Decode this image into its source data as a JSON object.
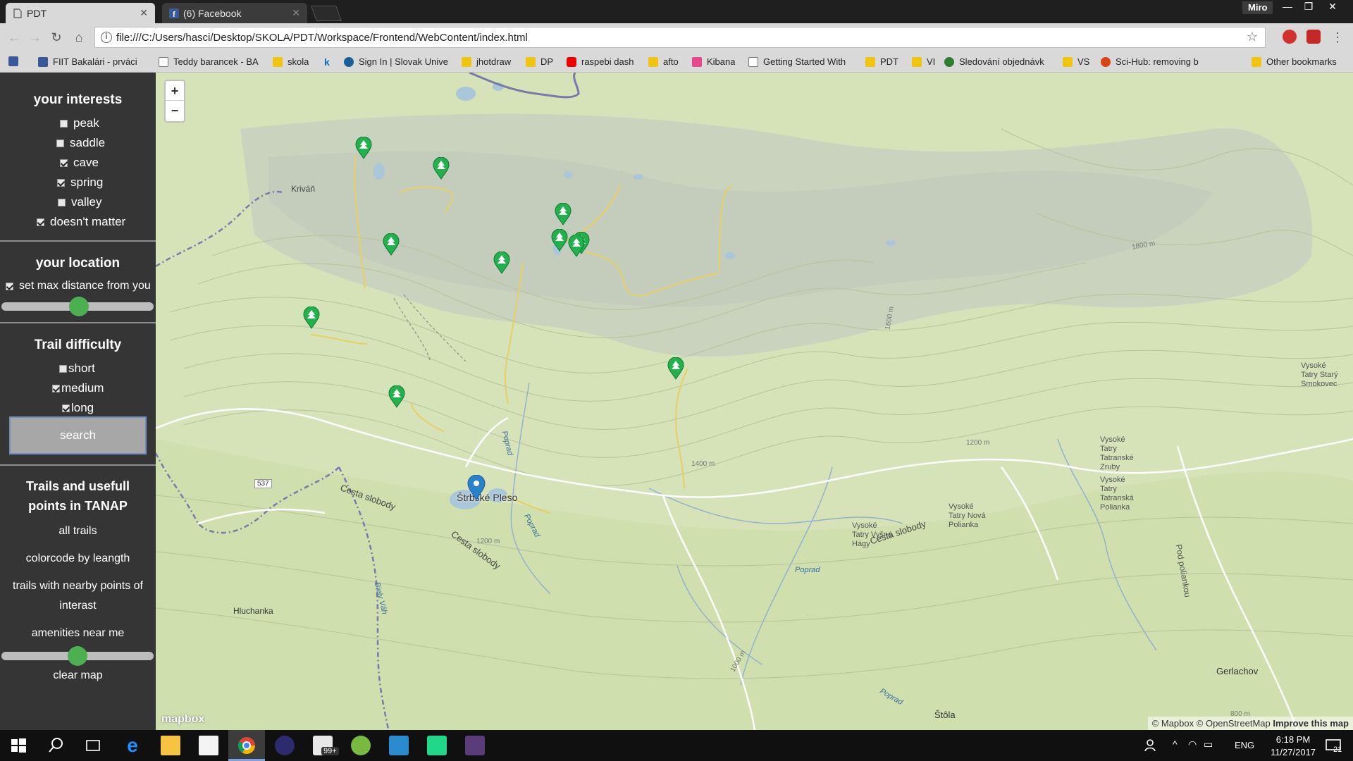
{
  "browser": {
    "tabs": [
      {
        "title": "PDT",
        "active": true
      },
      {
        "title": "(6) Facebook",
        "active": false
      }
    ],
    "user": "Miro",
    "url": "file:///C:/Users/hasci/Desktop/SKOLA/PDT/Workspace/Frontend/WebContent/index.html",
    "bookmarks": [
      {
        "label": "FIIT Bakalári - prváci",
        "icon": "facebook-icon"
      },
      {
        "label": "Teddy barancek - BA",
        "icon": "page-icon"
      },
      {
        "label": "skola",
        "icon": "folder-icon"
      },
      {
        "label": "",
        "icon": "k-icon"
      },
      {
        "label": "Sign In | Slovak Unive",
        "icon": "globe-icon"
      },
      {
        "label": "jhotdraw",
        "icon": "folder-icon"
      },
      {
        "label": "DP",
        "icon": "folder-icon"
      },
      {
        "label": "raspebi dash",
        "icon": "youtube-icon"
      },
      {
        "label": "afto",
        "icon": "folder-icon"
      },
      {
        "label": "Kibana",
        "icon": "kibana-icon"
      },
      {
        "label": "Getting Started With",
        "icon": "page-icon"
      },
      {
        "label": "PDT",
        "icon": "folder-icon"
      },
      {
        "label": "VI",
        "icon": "folder-icon"
      },
      {
        "label": "Sledování objednávk",
        "icon": "shield-icon"
      },
      {
        "label": "VS",
        "icon": "folder-icon"
      },
      {
        "label": "Sci-Hub: removing b",
        "icon": "scihub-icon"
      }
    ],
    "other_bookmarks": "Other bookmarks"
  },
  "panel": {
    "interests": {
      "title": "your interests",
      "items": [
        {
          "label": "peak",
          "checked": false
        },
        {
          "label": "saddle",
          "checked": false
        },
        {
          "label": "cave",
          "checked": true
        },
        {
          "label": "spring",
          "checked": true
        },
        {
          "label": "valley",
          "checked": false
        },
        {
          "label": "doesn't matter",
          "checked": true
        }
      ]
    },
    "location": {
      "title": "your location",
      "max_distance_label": "set max distance from you",
      "max_distance_checked": true,
      "slider_value": 0.5
    },
    "difficulty": {
      "title": "Trail difficulty",
      "items": [
        {
          "label": "short",
          "checked": false
        },
        {
          "label": "medium",
          "checked": true
        },
        {
          "label": "long",
          "checked": true
        }
      ],
      "search_label": "search"
    },
    "trails": {
      "title_line1": "Trails and usefull",
      "title_line2": "points in TANAP",
      "all_trails": "all trails",
      "colorcode": "colorcode by leangth",
      "nearby_line1": "trails with nearby points of",
      "nearby_line2": "interast",
      "amenities": "amenities near me",
      "amenities_slider_value": 0.5,
      "clear_map": "clear map"
    }
  },
  "map": {
    "zoom_in": "+",
    "zoom_out": "−",
    "labels": {
      "krivan": "Kriváň",
      "strbske_pleso": "Štrbské Pleso",
      "cesta_slobody_1": "Cesta slobody",
      "cesta_slobody_2": "Cesta slobody",
      "cesta_slobody_3": "Cesta slobody",
      "poprad_1": "Poprad",
      "poprad_2": "Poprad",
      "poprad_3": "Poprad",
      "poprad_4": "Poprad",
      "hluchanka": "Hluchanka",
      "biely_vah": "Biely Váh",
      "stola": "Štôla",
      "gerlachov": "Gerlachov",
      "pod_poliankou": "Pod poliankou",
      "vysne_hagy": "Vysoké Tatry Vyšné Hágy",
      "nova_polianka": "Vysoké Tatry Nová Polianka",
      "tatranske_zruby": "Vysoké Tatry Tatranské Zruby",
      "tatranska_polianka": "Vysoké Tatry Tatranská Polianka",
      "stary_smokovec": "Vysoké Tatry Starý Smokovec",
      "road_537": "537",
      "c1600_a": "1600 m",
      "c1400_a": "1400 m",
      "c1200_a": "1200 m",
      "c1200_b": "1200 m",
      "c1800_a": "1800 m",
      "c1000_a": "1000 m",
      "c800_a": "800 m"
    },
    "attribution_mapbox": "© Mapbox",
    "attribution_osm": "© OpenStreetMap",
    "attribution_improve": "Improve this map",
    "logo": "mapbox",
    "accent_green": "#22b14c",
    "marker_blue": "#2a81cb"
  },
  "taskbar": {
    "language": "ENG",
    "time": "6:18 PM",
    "date": "11/27/2017",
    "notifications": "21",
    "mail_badge": "99+"
  }
}
